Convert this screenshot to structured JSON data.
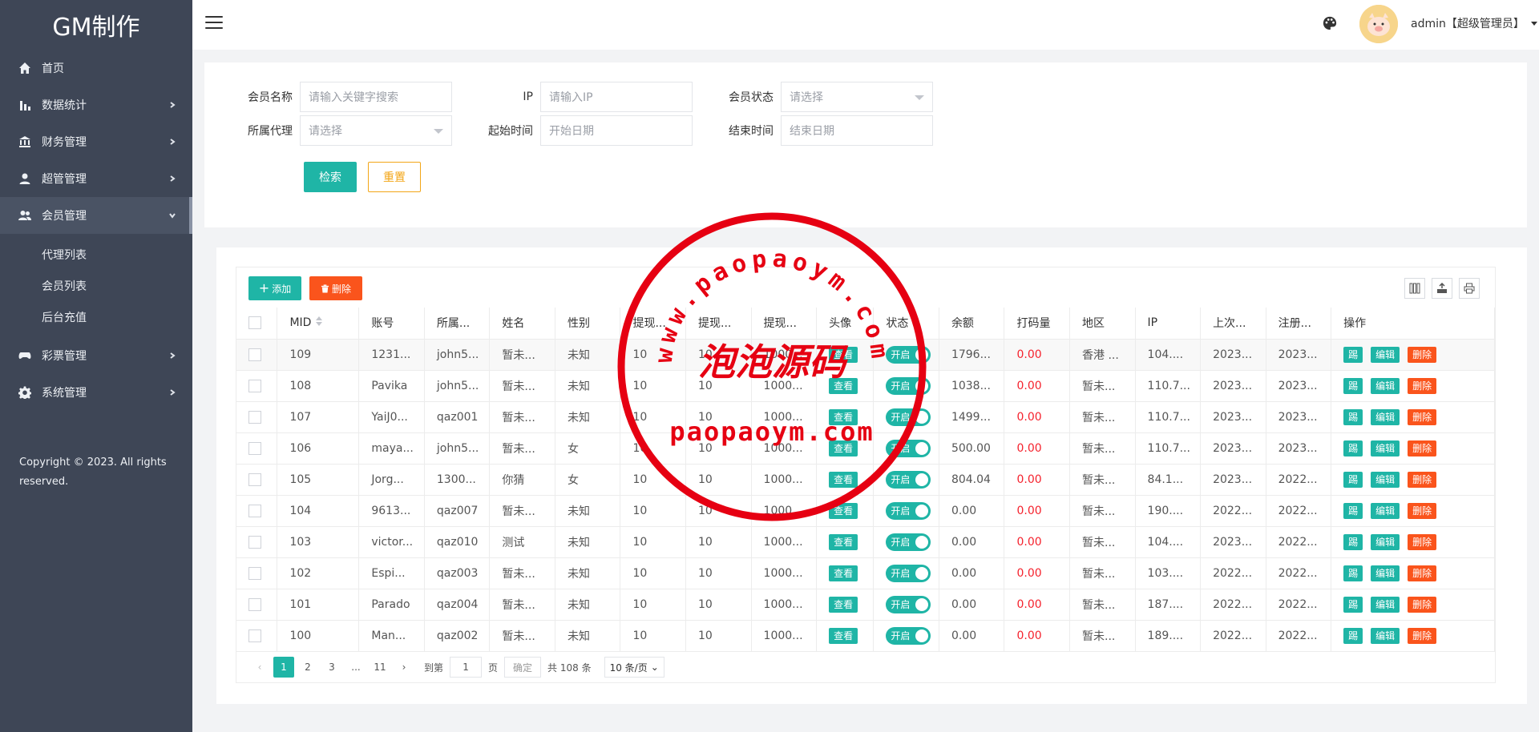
{
  "brand": "GM制作",
  "sidebar": {
    "items": [
      {
        "label": "首页",
        "icon": "home-icon"
      },
      {
        "label": "数据统计",
        "icon": "bar-chart-icon"
      },
      {
        "label": "财务管理",
        "icon": "bank-icon"
      },
      {
        "label": "超管管理",
        "icon": "user-icon"
      },
      {
        "label": "会员管理",
        "icon": "users-icon"
      },
      {
        "label": "彩票管理",
        "icon": "gamepad-icon"
      },
      {
        "label": "系统管理",
        "icon": "gear-icon"
      }
    ],
    "submenu": [
      "代理列表",
      "会员列表",
      "后台充值"
    ],
    "copyright": "Copyright © 2023. All rights reserved."
  },
  "header": {
    "username": "admin【超级管理员】"
  },
  "search": {
    "member_name_label": "会员名称",
    "member_name_placeholder": "请输入关键字搜索",
    "ip_label": "IP",
    "ip_placeholder": "请输入IP",
    "status_label": "会员状态",
    "status_value": "请选择",
    "agent_label": "所属代理",
    "agent_value": "请选择",
    "start_label": "起始时间",
    "start_placeholder": "开始日期",
    "end_label": "结束时间",
    "end_placeholder": "结束日期",
    "search_button": "检索",
    "reset_button": "重置"
  },
  "toolbar": {
    "add": "添加",
    "delete": "删除"
  },
  "table": {
    "columns": [
      "MID",
      "账号",
      "所属...",
      "姓名",
      "性别",
      "提现...",
      "提现...",
      "提现...",
      "头像",
      "状态",
      "余额",
      "打码量",
      "地区",
      "IP",
      "上次...",
      "注册...",
      "操作"
    ],
    "view_label": "查看",
    "switch_label": "开启",
    "op_labels": [
      "踢",
      "编辑",
      "删除"
    ],
    "rows": [
      [
        "109",
        "1231...",
        "john5...",
        "暂未...",
        "未知",
        "10",
        "10",
        "1000...",
        "1796...",
        "0.00",
        "香港 ...",
        "104....",
        "2023...",
        "2023..."
      ],
      [
        "108",
        "Pavika",
        "john5...",
        "暂未...",
        "未知",
        "10",
        "10",
        "1000...",
        "1038...",
        "0.00",
        "暂未...",
        "110.7...",
        "2023...",
        "2023..."
      ],
      [
        "107",
        "YaiJ0...",
        "qaz001",
        "暂未...",
        "未知",
        "10",
        "10",
        "1000...",
        "1499...",
        "0.00",
        "暂未...",
        "110.7...",
        "2023...",
        "2023..."
      ],
      [
        "106",
        "maya...",
        "john5...",
        "暂未...",
        "女",
        "10",
        "10",
        "1000...",
        "500.00",
        "0.00",
        "暂未...",
        "110.7...",
        "2023...",
        "2023..."
      ],
      [
        "105",
        "Jorg...",
        "1300...",
        "你猜",
        "女",
        "10",
        "10",
        "1000...",
        "804.04",
        "0.00",
        "暂未...",
        "84.1...",
        "2023...",
        "2022..."
      ],
      [
        "104",
        "9613...",
        "qaz007",
        "暂未...",
        "未知",
        "10",
        "10",
        "1000...",
        "0.00",
        "0.00",
        "暂未...",
        "190....",
        "2022...",
        "2022..."
      ],
      [
        "103",
        "victor...",
        "qaz010",
        "测试",
        "未知",
        "10",
        "10",
        "1000...",
        "0.00",
        "0.00",
        "暂未...",
        "104....",
        "2023...",
        "2022..."
      ],
      [
        "102",
        "Espi...",
        "qaz003",
        "暂未...",
        "未知",
        "10",
        "10",
        "1000...",
        "0.00",
        "0.00",
        "暂未...",
        "103....",
        "2022...",
        "2022..."
      ],
      [
        "101",
        "Parado",
        "qaz004",
        "暂未...",
        "未知",
        "10",
        "10",
        "1000...",
        "0.00",
        "0.00",
        "暂未...",
        "187....",
        "2022...",
        "2022..."
      ],
      [
        "100",
        "Man...",
        "qaz002",
        "暂未...",
        "未知",
        "10",
        "10",
        "1000...",
        "0.00",
        "0.00",
        "暂未...",
        "189....",
        "2022...",
        "2022..."
      ]
    ]
  },
  "pagination": {
    "pages": [
      "1",
      "2",
      "3",
      "...",
      "11"
    ],
    "goto_label": "到第",
    "page_value": "1",
    "page_unit": "页",
    "confirm": "确定",
    "total": "共 108 条",
    "page_size": "10 条/页"
  },
  "watermark": {
    "arc_text": "www.paopaoym.com",
    "center_text": "泡泡源码",
    "bottom_text": "paopaoym.com"
  }
}
